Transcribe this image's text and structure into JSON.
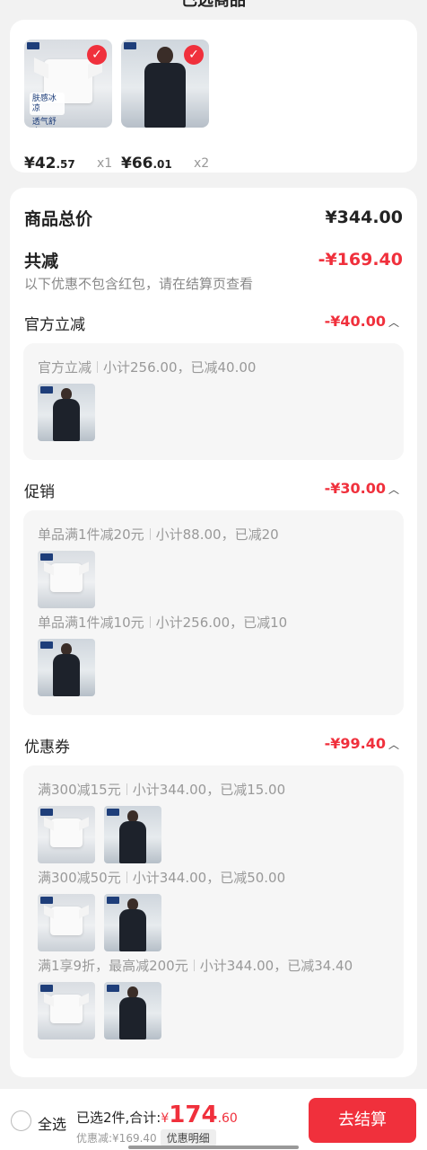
{
  "header": {
    "cut_title": "已选商品"
  },
  "selected_items": [
    {
      "price_int": "¥42",
      "price_dec": ".57",
      "qty": "x1",
      "promo_text": [
        "肤感冰凉",
        "透气舒爽"
      ],
      "type": "white"
    },
    {
      "price_int": "¥66",
      "price_dec": ".01",
      "qty": "x2",
      "type": "black"
    }
  ],
  "summary": {
    "total_label": "商品总价",
    "total_value": "¥344.00",
    "reduce_label": "共减",
    "reduce_value": "-¥169.40",
    "note": "以下优惠不包含红包，请在结算页查看"
  },
  "sections": {
    "official": {
      "title": "官方立减",
      "value": "-¥40.00",
      "rule": "官方立减",
      "detail": "小计256.00，已减40.00"
    },
    "promo": {
      "title": "促销",
      "value": "-¥30.00",
      "rules": [
        {
          "rule": "单品满1件减20元",
          "detail": "小计88.00，已减20"
        },
        {
          "rule": "单品满1件减10元",
          "detail": "小计256.00，已减10"
        }
      ]
    },
    "coupon": {
      "title": "优惠券",
      "value": "-¥99.40",
      "rules": [
        {
          "rule": "满300减15元",
          "detail": "小计344.00，已减15.00"
        },
        {
          "rule": "满300减50元",
          "detail": "小计344.00，已减50.00"
        },
        {
          "rule": "满1享9折，最高减200元",
          "detail": "小计344.00，已减34.40"
        }
      ]
    }
  },
  "bottom": {
    "select_all": "全选",
    "selected_text": "已选2件,合计:",
    "currency": "¥",
    "total_int": "174",
    "total_dec": ".60",
    "discount_text": "优惠减:¥169.40",
    "detail_button": "优惠明细",
    "checkout_button": "去结算"
  },
  "colors": {
    "accent": "#f0303c",
    "background": "#f2f2f2"
  },
  "icons": {
    "check": "check-icon",
    "chevron": "chevron-up-icon",
    "radio": "radio-unchecked-icon"
  }
}
